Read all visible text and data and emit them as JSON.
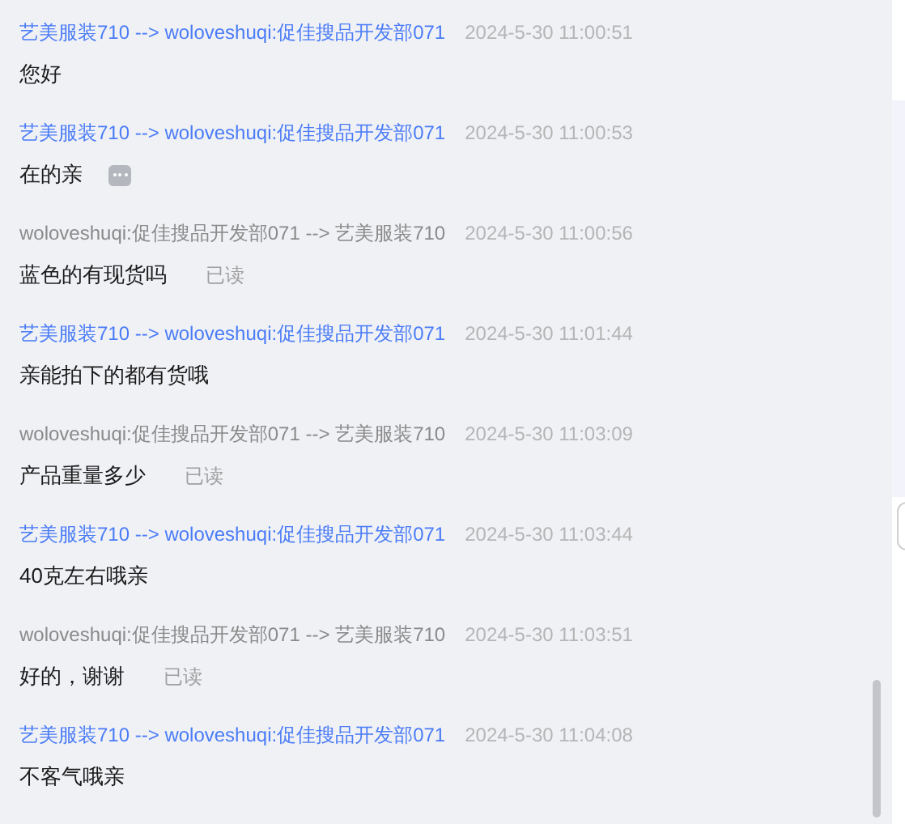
{
  "messages": [
    {
      "kind": "outgoing",
      "header": "艺美服装710 --> woloveshuqi:促佳搜品开发部071",
      "time": "2024-5-30 11:00:51",
      "text": "您好",
      "more": false
    },
    {
      "kind": "outgoing",
      "header": "艺美服装710 --> woloveshuqi:促佳搜品开发部071",
      "time": "2024-5-30 11:00:53",
      "text": "在的亲",
      "more": true
    },
    {
      "kind": "incoming",
      "header": "woloveshuqi:促佳搜品开发部071 --> 艺美服装710",
      "time": "2024-5-30 11:00:56",
      "text": "蓝色的有现货吗",
      "status": "已读",
      "more": false
    },
    {
      "kind": "outgoing",
      "header": "艺美服装710 --> woloveshuqi:促佳搜品开发部071",
      "time": "2024-5-30 11:01:44",
      "text": "亲能拍下的都有货哦",
      "more": false
    },
    {
      "kind": "incoming",
      "header": "woloveshuqi:促佳搜品开发部071 --> 艺美服装710",
      "time": "2024-5-30 11:03:09",
      "text": "产品重量多少",
      "status": "已读",
      "more": false
    },
    {
      "kind": "outgoing",
      "header": "艺美服装710 --> woloveshuqi:促佳搜品开发部071",
      "time": "2024-5-30 11:03:44",
      "text": "40克左右哦亲",
      "more": false
    },
    {
      "kind": "incoming",
      "header": "woloveshuqi:促佳搜品开发部071 --> 艺美服装710",
      "time": "2024-5-30 11:03:51",
      "text": "好的，谢谢",
      "status": "已读",
      "more": false
    },
    {
      "kind": "outgoing",
      "header": "艺美服装710 --> woloveshuqi:促佳搜品开发部071",
      "time": "2024-5-30 11:04:08",
      "text": "不客气哦亲",
      "more": false
    }
  ]
}
